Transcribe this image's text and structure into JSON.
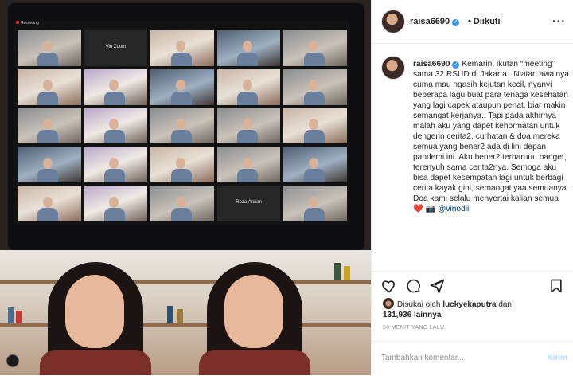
{
  "colors": {
    "accent": "#3897f0",
    "mention": "#00376b",
    "muted": "#8e8e8e",
    "like_heart": "#ed4956"
  },
  "post": {
    "username": "raisa6690",
    "follow_state": "• Diikuti",
    "more_icon": "more-dots-icon"
  },
  "zoom": {
    "recording_label": "Recording",
    "tiles": [
      {
        "label": ""
      },
      {
        "label": "Vin Zoom"
      },
      {
        "label": ""
      },
      {
        "label": ""
      },
      {
        "label": ""
      },
      {
        "label": ""
      },
      {
        "label": ""
      },
      {
        "label": ""
      },
      {
        "label": ""
      },
      {
        "label": ""
      },
      {
        "label": ""
      },
      {
        "label": ""
      },
      {
        "label": ""
      },
      {
        "label": ""
      },
      {
        "label": ""
      },
      {
        "label": ""
      },
      {
        "label": ""
      },
      {
        "label": ""
      },
      {
        "label": ""
      },
      {
        "label": ""
      },
      {
        "label": ""
      },
      {
        "label": ""
      },
      {
        "label": ""
      },
      {
        "label": "Reza Ardian"
      },
      {
        "label": ""
      }
    ]
  },
  "caption": {
    "username": "raisa6690",
    "text": "Kemarin, ikutan “meeting” sama 32 RSUD di Jakarta.. Niatan awalnya cuma mau ngasih kejutan kecil, nyanyi beberapa lagu buat para tenaga kesehatan yang lagi capek ataupun penat, biar makin semangat kerjanya.. Tapi pada akhirnya malah aku yang dapet kehormatan untuk dengerin cerita2, curhatan & doa mereka semua yang bener2 ada di lini depan pandemi ini. Aku bener2 terharuuu banget, terenyuh sama cerita2nya. Semoga aku bisa dapet kesempatan lagi untuk berbagi cerita kayak gini, semangat yaa semuanya. Doa kami selalu menyertai kalian semua",
    "emoji": "❤️ 📷",
    "mention": "@vinodii"
  },
  "actions": {
    "like_icon": "heart-icon",
    "comment_icon": "comment-icon",
    "share_icon": "share-icon",
    "save_icon": "bookmark-icon"
  },
  "likes": {
    "prefix": "Disukai oleh",
    "user": "luckyekaputra",
    "middle": "dan",
    "count": "131,936",
    "suffix": "lainnya"
  },
  "timestamp": "50 MENIT YANG LALU",
  "comment": {
    "placeholder": "Tambahkan komentar...",
    "send_label": "Kirim"
  }
}
